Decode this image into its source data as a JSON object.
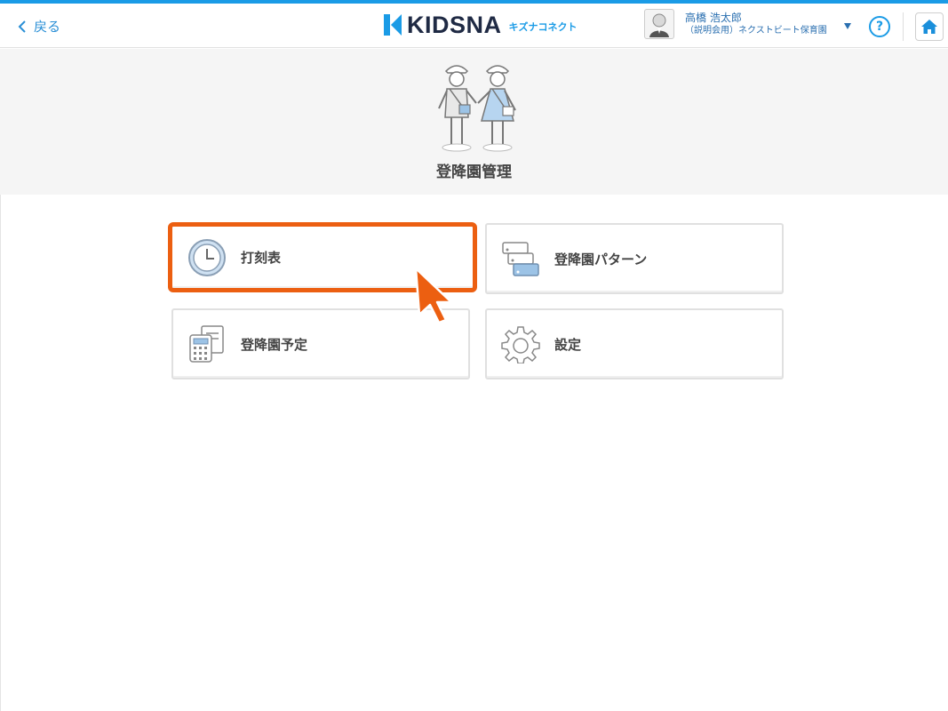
{
  "header": {
    "back_label": "戻る",
    "brand": "KIDSNA",
    "brand_sub": "キズナコネクト",
    "user_name": "高橋 浩太郎",
    "user_org": "（説明会用）ネクストビート保育園",
    "help_label": "?"
  },
  "hero": {
    "title": "登降園管理"
  },
  "menu": {
    "items": [
      {
        "label": "打刻表",
        "icon": "clock-icon"
      },
      {
        "label": "登降園パターン",
        "icon": "pattern-cards-icon"
      },
      {
        "label": "登降園予定",
        "icon": "schedule-calculator-icon"
      },
      {
        "label": "設定",
        "icon": "gear-icon"
      }
    ]
  },
  "colors": {
    "accent": "#1a9be6",
    "highlight": "#ec5f11",
    "link": "#2a8fd6",
    "brand_dark": "#1f2a44"
  }
}
